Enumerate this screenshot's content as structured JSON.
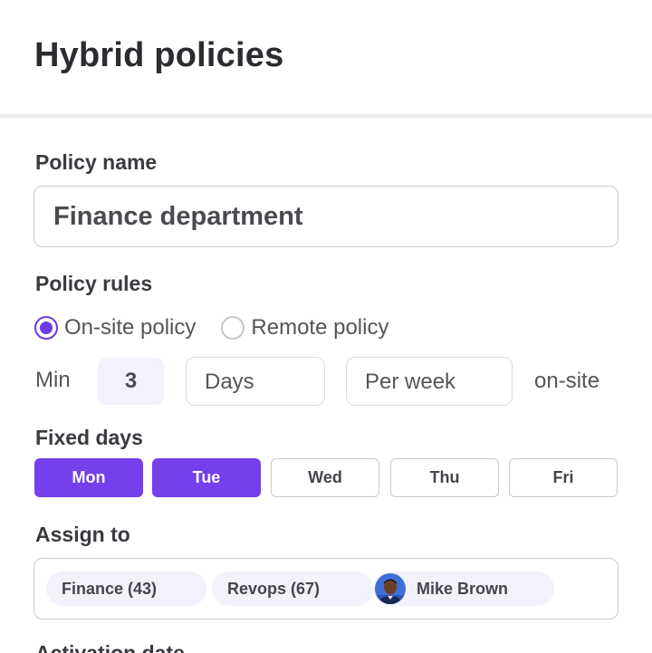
{
  "header": {
    "title": "Hybrid policies"
  },
  "policy_name": {
    "label": "Policy name",
    "value": "Finance department"
  },
  "policy_rules": {
    "label": "Policy rules",
    "options": [
      {
        "label": "On-site policy",
        "checked": true
      },
      {
        "label": "Remote policy",
        "checked": false
      }
    ],
    "min_label": "Min",
    "count": "3",
    "unit": "Days",
    "period": "Per week",
    "suffix": "on-site"
  },
  "fixed_days": {
    "label": "Fixed days",
    "days": [
      {
        "label": "Mon",
        "selected": true
      },
      {
        "label": "Tue",
        "selected": true
      },
      {
        "label": "Wed",
        "selected": false
      },
      {
        "label": "Thu",
        "selected": false
      },
      {
        "label": "Fri",
        "selected": false
      }
    ]
  },
  "assign_to": {
    "label": "Assign to",
    "chips": [
      {
        "label": "Finance (43)"
      },
      {
        "label": "Revops (67)"
      },
      {
        "label": "Mike Brown",
        "avatar": "person-avatar"
      }
    ]
  },
  "activation_date": {
    "label": "Activation date"
  },
  "colors": {
    "accent": "#7340ec",
    "radio_accent": "#6c3be3",
    "chip_bg": "#f1f2fb"
  }
}
